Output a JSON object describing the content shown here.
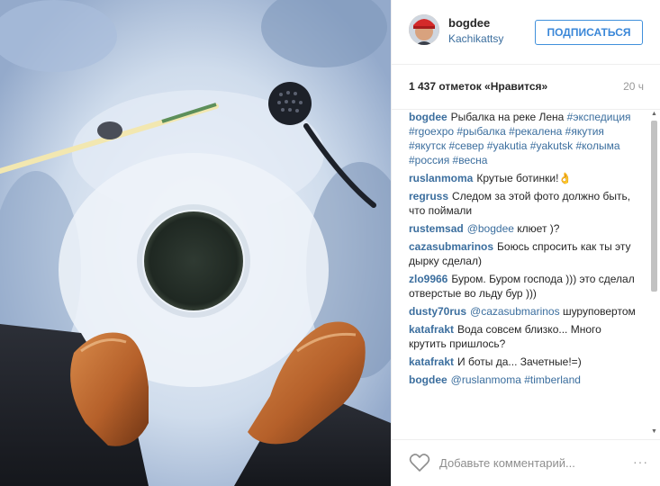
{
  "post": {
    "username": "bogdee",
    "location": "Kachikattsy",
    "follow_label": "ПОДПИСАТЬСЯ",
    "likes": "1 437 отметок «Нравится»",
    "time": "20 ч"
  },
  "comments": [
    {
      "user": "bogdee",
      "text": "Рыбалка на реке Лена",
      "tags": "#экспедиция #rgoexpo #рыбалка #рекалена #якутия #якутск #север #yakutia #yakutsk #колыма #россия #весна"
    },
    {
      "user": "ruslanmoma",
      "text": "Крутые ботинки!👌",
      "tags": ""
    },
    {
      "user": "regruss",
      "text": "Следом за этой фото должно быть, что поймали",
      "tags": ""
    },
    {
      "user": "rustemsad",
      "mention": "@bogdee",
      "text": "клюет )?",
      "tags": ""
    },
    {
      "user": "cazasubmarinos",
      "text": "Боюсь спросить как ты эту дырку сделал)",
      "tags": ""
    },
    {
      "user": "zlo9966",
      "text": "Буром. Буром господа ))) это сделал отверстые во льду бур )))",
      "tags": ""
    },
    {
      "user": "dusty70rus",
      "mention": "@cazasubmarinos",
      "text": "шуруповертом",
      "tags": ""
    },
    {
      "user": "katafrakt",
      "text": "Вода совсем близко... Много крутить пришлось?",
      "tags": ""
    },
    {
      "user": "katafrakt",
      "text": "И боты да... Зачетные!=)",
      "tags": ""
    },
    {
      "user": "bogdee",
      "mention": "@ruslanmoma",
      "text": "",
      "tags": "#timberland"
    }
  ],
  "composer": {
    "placeholder": "Добавьте комментарий...",
    "more": "···"
  },
  "colors": {
    "link": "#3b6e9e",
    "follow": "#3a87d8"
  },
  "icons": {
    "like": "heart-icon",
    "more": "more-options-icon",
    "scroll_up": "chevron-up-icon",
    "scroll_down": "chevron-down-icon"
  }
}
